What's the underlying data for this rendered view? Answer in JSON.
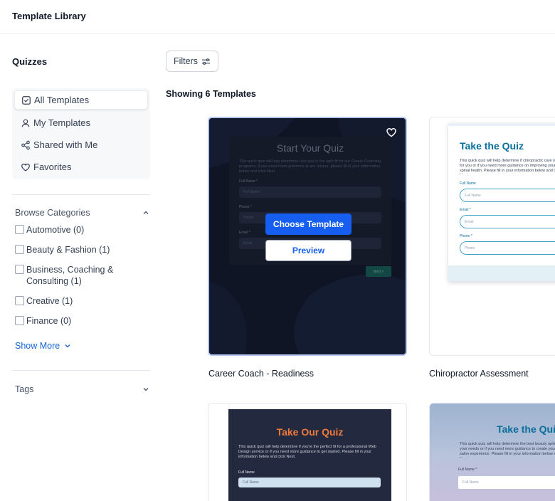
{
  "header": {
    "title": "Template Library"
  },
  "sidebar": {
    "heading": "Quizzes",
    "nav": [
      {
        "label": "All Templates",
        "icon": "checkbox-icon",
        "active": true
      },
      {
        "label": "My Templates",
        "icon": "user-icon",
        "active": false
      },
      {
        "label": "Shared with Me",
        "icon": "share-icon",
        "active": false
      },
      {
        "label": "Favorites",
        "icon": "heart-icon",
        "active": false
      }
    ],
    "categories_label": "Browse Categories",
    "categories": [
      {
        "label": "Automotive (0)"
      },
      {
        "label": "Beauty & Fashion (1)"
      },
      {
        "label": "Business, Coaching & Consulting (1)"
      },
      {
        "label": "Creative (1)"
      },
      {
        "label": "Finance (0)"
      }
    ],
    "show_more": "Show More",
    "tags_label": "Tags"
  },
  "main": {
    "filters_label": "Filters",
    "showing_text": "Showing 6 Templates",
    "templates": [
      {
        "name": "Career Coach - Readiness",
        "preview_title": "Start Your Quiz",
        "preview_body": "This quick quiz will help determine how you're the right fit for our Career Coaching programs. If you need more guidance or are unsure, please fill in your information below and click Next.",
        "fields": [
          "Full Name *",
          "Phone *",
          "Email *"
        ],
        "placeholders": [
          "Full Name",
          "Phone",
          "Email"
        ],
        "next_label": "Next >",
        "choose_label": "Choose Template",
        "preview_label": "Preview"
      },
      {
        "name": "Chiropractor Assessment",
        "preview_title": "Take the Quiz",
        "preview_body": "This quick quiz will help determine if chiropractic care is right for you or if you need more guidance on improving your spinal health. Please fill in your information below and click Next.",
        "fields": [
          "Full Name",
          "Email *",
          "Phone *"
        ],
        "placeholders": [
          "Full Name",
          "Email",
          "Phone"
        ]
      },
      {
        "name": "",
        "preview_title": "Take Our Quiz",
        "preview_body": "This quick quiz will help determine if you're the perfect fit for a professional Web Design service or if you need more guidance to get started. Please fill in your information below and click Next.",
        "fields": [
          "Full Name"
        ],
        "placeholders": [
          "Full Name"
        ]
      },
      {
        "name": "",
        "preview_title": "Take the Quiz",
        "preview_body": "This quick quiz will help determine the best beauty options for your needs or if you need more guidance to create your perfect salon experience. Please fill in your information below and click Next.",
        "fields": [
          "Full Name *"
        ],
        "placeholders": [
          "Full Name"
        ]
      }
    ]
  },
  "colors": {
    "accent": "#155eef",
    "link": "#1565d8",
    "teal_title": "#0a6e9a",
    "orange_title": "#f07a3a"
  }
}
